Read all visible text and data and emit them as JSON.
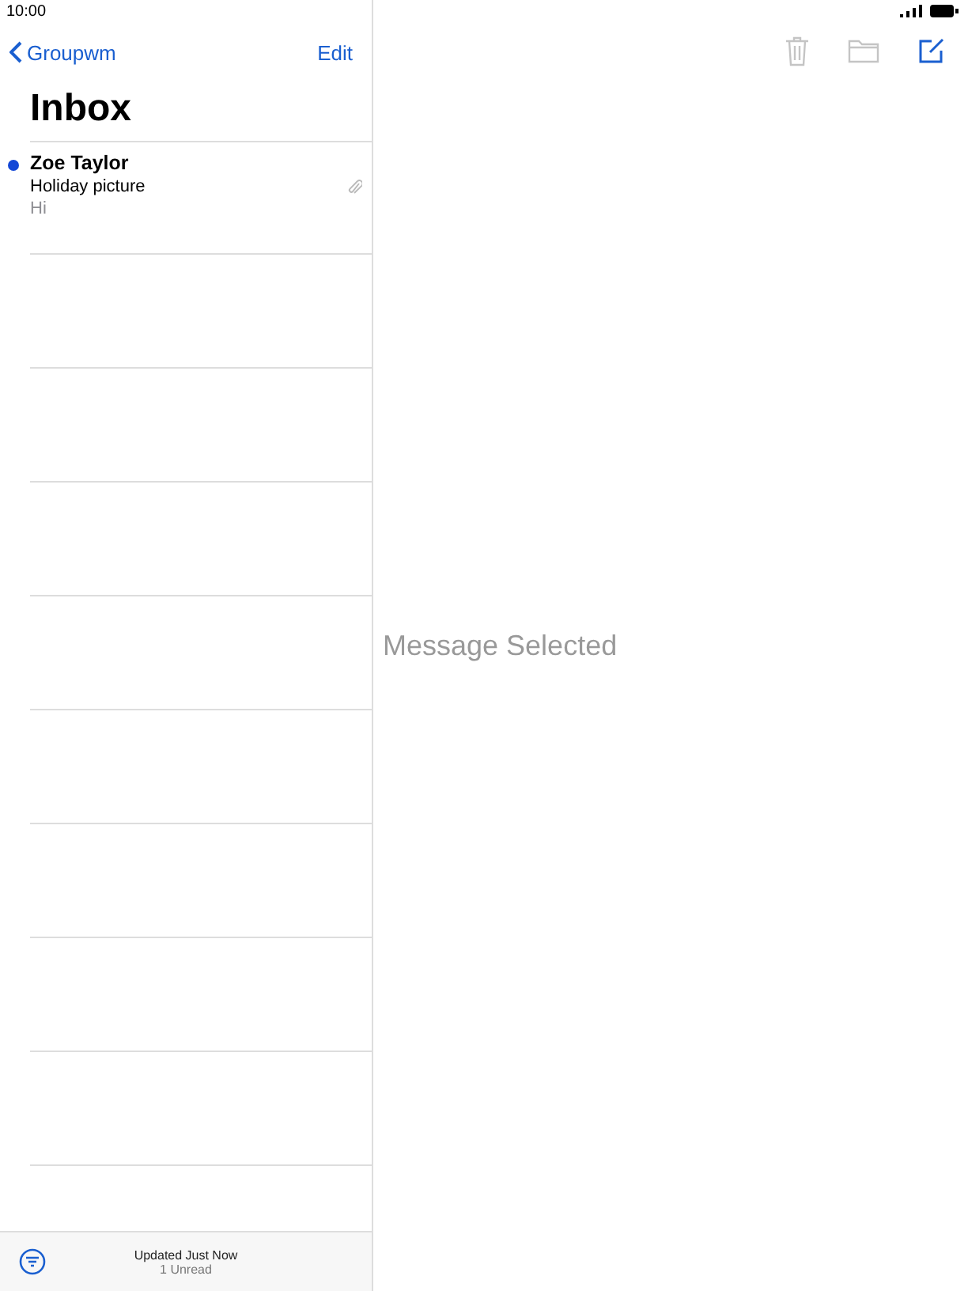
{
  "status_bar": {
    "time": "10:00"
  },
  "sidebar": {
    "back_label": "Groupwm",
    "edit_label": "Edit",
    "title": "Inbox",
    "messages": [
      {
        "sender": "Zoe Taylor",
        "subject": "Holiday picture",
        "preview": "Hi",
        "unread": true,
        "attachment": true
      }
    ],
    "footer": {
      "status": "Updated Just Now",
      "unread_count": "1 Unread"
    }
  },
  "detail": {
    "toolbar": [
      {
        "kind": "trash",
        "disabled": true
      },
      {
        "kind": "folder",
        "disabled": true
      },
      {
        "kind": "compose",
        "disabled": false
      }
    ],
    "empty_text": "Message Selected"
  }
}
